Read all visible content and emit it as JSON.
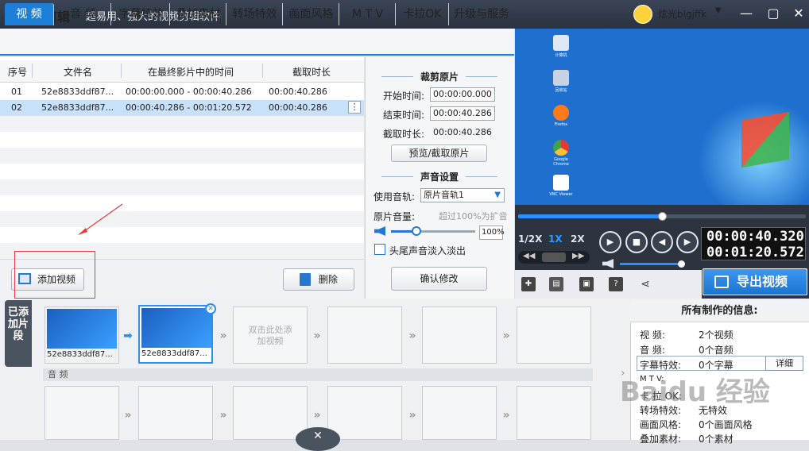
{
  "title": {
    "app_name": "爱剪辑",
    "slogan": "超易用、强大的视频剪辑软件",
    "username": "炫光blgjffk"
  },
  "tabs": [
    {
      "label": "视  频",
      "active": true
    },
    {
      "label": "音  频"
    },
    {
      "label": "字幕特效"
    },
    {
      "label": "叠加素材"
    },
    {
      "label": "转场特效"
    },
    {
      "label": "画面风格"
    },
    {
      "label": "M T V"
    },
    {
      "label": "卡拉OK"
    },
    {
      "label": "升级与服务"
    }
  ],
  "table": {
    "headers": [
      "序号",
      "文件名",
      "在最终影片中的时间",
      "截取时长"
    ],
    "rows": [
      {
        "index": "01",
        "file": "52e8833ddf87...",
        "range": "00:00:00.000 - 00:00:40.286",
        "duration": "00:00:40.286"
      },
      {
        "index": "02",
        "file": "52e8833ddf87...",
        "range": "00:00:40.286 - 00:01:20.572",
        "duration": "00:00:40.286",
        "selected": true
      }
    ],
    "row_menu": "⋮"
  },
  "buttons": {
    "add_video": "添加视频",
    "delete": "删除",
    "preview_cut": "预览/截取原片",
    "confirm": "确认修改"
  },
  "cut": {
    "title": "裁剪原片",
    "start_label": "开始时间:",
    "start_value": "00:00:00.000",
    "end_label": "结束时间:",
    "end_value": "00:00:40.286",
    "duration_label": "截取时长:",
    "duration_value": "00:00:40.286"
  },
  "audio": {
    "title": "声音设置",
    "track_label": "使用音轨:",
    "track_value": "原片音轨1",
    "volume_label": "原片音量:",
    "volume_hint": "超过100%为扩音",
    "volume_value": "100%",
    "volume_level": 0.3,
    "fade_label": "头尾声音淡入淡出"
  },
  "preview": {
    "desktop_icons": [
      "计算机",
      "回收站",
      "Firefox",
      "Google Chrome",
      "VNC Viewer"
    ],
    "seek_progress": 0.5
  },
  "player": {
    "speeds": [
      "1/2X",
      "1X",
      "2X"
    ],
    "active_speed": "1X",
    "current_time": "00:00:40.320",
    "total_time": "00:01:20.572",
    "volume_level": 1.0
  },
  "export": {
    "label": "导出视频"
  },
  "clips": {
    "side_tab": "已添加片段",
    "items": [
      {
        "label": "52e8833ddf87..."
      },
      {
        "label": "52e8833ddf87...",
        "selected": true
      }
    ],
    "placeholder": "双击此处添加视频",
    "audio_header": "音 频"
  },
  "info": {
    "title": "所有制作的信息:",
    "rows": [
      {
        "key": "视    频:",
        "value": "2个视频"
      },
      {
        "key": "音    频:",
        "value": "0个音频"
      },
      {
        "key": "字幕特效:",
        "value": "0个字幕"
      },
      {
        "key": "M  T  V:",
        "value": ""
      },
      {
        "key": "卡  拉 OK:",
        "value": ""
      },
      {
        "key": "转场特效:",
        "value": "无特效"
      },
      {
        "key": "画面风格:",
        "value": "0个画面风格"
      },
      {
        "key": "叠加素材:",
        "value": "0个素材"
      }
    ],
    "detail_button": "详细"
  },
  "watermark": "Baidu 经验",
  "colors": {
    "accent": "#1e7fd8",
    "titlebar": "#2a323f",
    "annotation": "#e23b3b"
  }
}
